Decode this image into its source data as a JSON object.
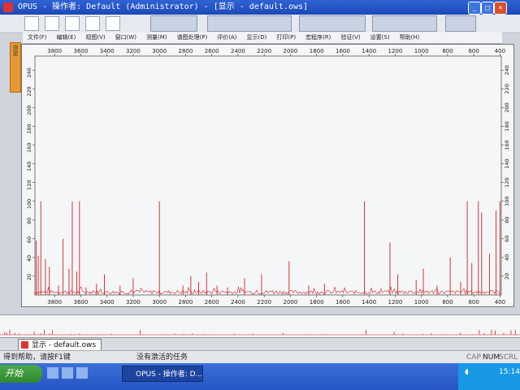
{
  "window": {
    "title": "OPUS - 操作者: Default  (Administrator) - [显示 - default.ows]"
  },
  "menu": [
    "文件(F)",
    "编辑(E)",
    "视图(V)",
    "窗口(W)",
    "测量(M)",
    "谱图处理(P)",
    "评价(A)",
    "显示(D)",
    "打印(P)",
    "宏程序(R)",
    "验证(V)",
    "设置(S)",
    "帮助(H)"
  ],
  "side_tab": {
    "label": "浏览"
  },
  "document_tab": {
    "label": "显示 - default.ows"
  },
  "status": {
    "help": "得到帮助，请按F1键",
    "tasks": "没有激活的任务",
    "caps": "CAP",
    "num": "NUM",
    "scrl": "SCRL"
  },
  "taskbar": {
    "start": "开始",
    "task": "OPUS - 操作者: D...",
    "clock": "15:14"
  },
  "colors": {
    "trace": "#d42020",
    "plot_bg": "#f4f6f8"
  },
  "chart_data": {
    "type": "line",
    "title": "",
    "xlabel": "",
    "ylabel": "",
    "xlim": [
      3950,
      390
    ],
    "ylim": [
      0,
      255
    ],
    "x_ticks": [
      3800,
      3600,
      3400,
      3200,
      3000,
      2800,
      2600,
      2400,
      2200,
      2000,
      1800,
      1600,
      1400,
      1200,
      1000,
      800,
      600,
      400
    ],
    "y_ticks": [
      20,
      40,
      60,
      80,
      100,
      120,
      140,
      160,
      180,
      200,
      220,
      240
    ],
    "series": [
      {
        "peaks": [
          [
            3940,
            58
          ],
          [
            3925,
            42
          ],
          [
            3905,
            100
          ],
          [
            3870,
            38
          ],
          [
            3840,
            30
          ],
          [
            3770,
            10
          ],
          [
            3735,
            60
          ],
          [
            3690,
            28
          ],
          [
            3665,
            100
          ],
          [
            3630,
            25
          ],
          [
            3610,
            100
          ],
          [
            3560,
            8
          ],
          [
            3480,
            12
          ],
          [
            3420,
            22
          ],
          [
            3300,
            10
          ],
          [
            3200,
            18
          ],
          [
            3000,
            100
          ],
          [
            2820,
            10
          ],
          [
            2760,
            20
          ],
          [
            2700,
            14
          ],
          [
            2640,
            24
          ],
          [
            2560,
            10
          ],
          [
            2480,
            8
          ],
          [
            2350,
            18
          ],
          [
            2220,
            22
          ],
          [
            2010,
            36
          ],
          [
            1860,
            10
          ],
          [
            1740,
            12
          ],
          [
            1435,
            100
          ],
          [
            1240,
            56
          ],
          [
            1180,
            22
          ],
          [
            1040,
            16
          ],
          [
            985,
            28
          ],
          [
            880,
            10
          ],
          [
            780,
            40
          ],
          [
            700,
            14
          ],
          [
            650,
            100
          ],
          [
            615,
            34
          ],
          [
            565,
            100
          ],
          [
            540,
            88
          ],
          [
            480,
            44
          ],
          [
            430,
            90
          ],
          [
            400,
            100
          ]
        ]
      }
    ]
  }
}
